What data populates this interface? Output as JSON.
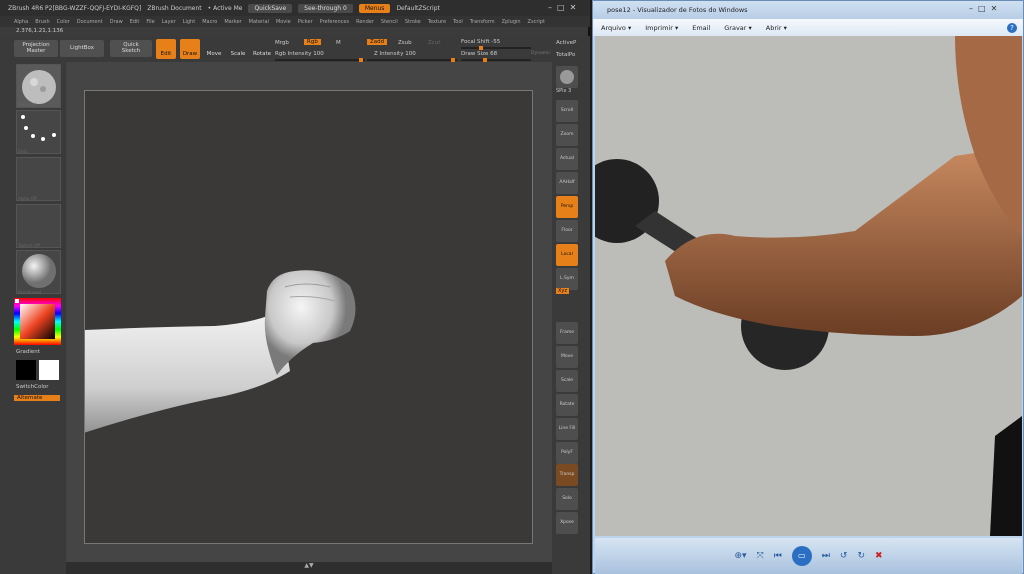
{
  "zbrush": {
    "title": "ZBrush 4R6 P2[BBG-WZZF-QQFJ-EYDI-KGFQ]",
    "document": "ZBrush Document",
    "active": "• Active Me",
    "quicksave": "QuickSave",
    "seethrough": "See-through",
    "seethrough_value": "0",
    "menus_btn": "Menus",
    "script": "DefaultZScript",
    "menu": [
      "Alpha",
      "Brush",
      "Color",
      "Document",
      "Draw",
      "Edit",
      "File",
      "Layer",
      "Light",
      "Macro",
      "Marker",
      "Material",
      "Movie",
      "Picker",
      "Preferences",
      "Render",
      "Stencil",
      "Stroke",
      "Texture",
      "Tool",
      "Transform",
      "Zplugin",
      "Zscript"
    ],
    "coords": "2.376,1.21,1.136",
    "toolbar": {
      "projection_master": "Projection\nMaster",
      "lightbox": "LightBox",
      "quick_sketch": "Quick\nSketch",
      "edit": "Edit",
      "draw": "Draw",
      "move": "Move",
      "scale": "Scale",
      "rotate": "Rotate",
      "mrgb": "Mrgb",
      "rgb": "Rgb",
      "m": "M",
      "rgb_intensity": "Rgb Intensity 100",
      "zadd": "Zadd",
      "zsub": "Zsub",
      "zcut": "Zcut",
      "z_intensity": "Z Intensity 100",
      "focal_shift": "Focal Shift -55",
      "draw_size": "Draw Size 68",
      "dynamic": "Dynamic",
      "activepoints": "ActiveP",
      "totalpoints": "TotalPo"
    },
    "left": {
      "brush_label": "Standard",
      "stroke_label": "Dots",
      "alpha_label": "Alpha Off",
      "texture_label": "Texture Off",
      "material_label": "SkinShade4",
      "gradient": "Gradient",
      "switchcolor": "SwitchColor",
      "alternate": "Alternate"
    },
    "right": {
      "bpr": "BPR",
      "spix": "SPix 3",
      "scroll": "Scroll",
      "zoom": "Zoom",
      "actual": "Actual",
      "aahalf": "AAHalf",
      "persp": "Persp",
      "floor": "Floor",
      "local": "Local",
      "lsym": "L.Sym",
      "xyz": "Xyz",
      "frame": "Frame",
      "move": "Move",
      "scale": "Scale",
      "rotate": "Rotate",
      "linefill": "Line Fill",
      "polyf": "PolyF",
      "transp": "Transp",
      "solo": "Solo",
      "xpose": "Xpose"
    },
    "colors": {
      "accent": "#e8801a",
      "panel": "#3a3a3a",
      "canvas": "#3b3838"
    }
  },
  "viewer": {
    "title": "pose12 - Visualizador de Fotos do Windows",
    "menu": [
      "Arquivo ▾",
      "Imprimir ▾",
      "Email",
      "Gravar ▾",
      "Abrir ▾"
    ],
    "help": "?"
  }
}
